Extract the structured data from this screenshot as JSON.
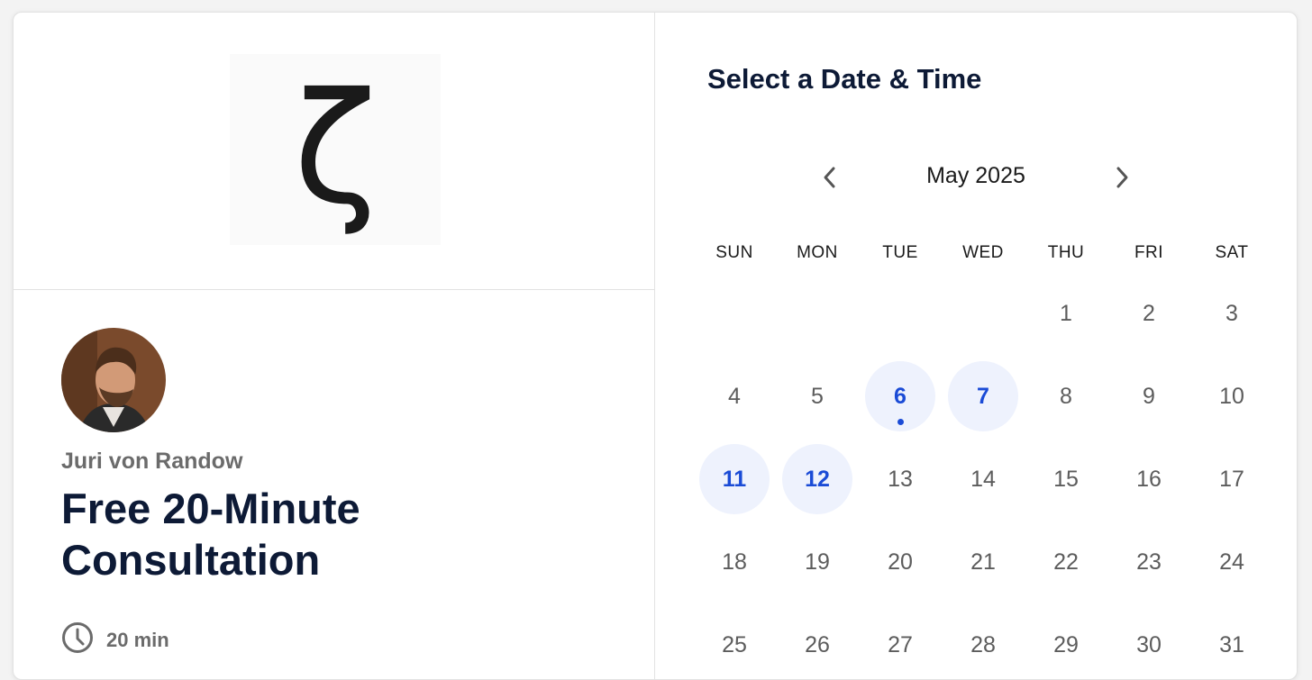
{
  "organizer": {
    "name": "Juri von Randow"
  },
  "event": {
    "title": "Free 20-Minute Consultation",
    "duration": "20 min"
  },
  "logo": {
    "glyph": "ζ"
  },
  "scheduler": {
    "heading": "Select a Date & Time",
    "month_label": "May 2025",
    "weekdays": [
      "SUN",
      "MON",
      "TUE",
      "WED",
      "THU",
      "FRI",
      "SAT"
    ],
    "days": [
      {
        "label": "",
        "available": false
      },
      {
        "label": "",
        "available": false
      },
      {
        "label": "",
        "available": false
      },
      {
        "label": "",
        "available": false
      },
      {
        "label": "1",
        "available": false
      },
      {
        "label": "2",
        "available": false
      },
      {
        "label": "3",
        "available": false
      },
      {
        "label": "4",
        "available": false
      },
      {
        "label": "5",
        "available": false
      },
      {
        "label": "6",
        "available": true,
        "today": true
      },
      {
        "label": "7",
        "available": true
      },
      {
        "label": "8",
        "available": false
      },
      {
        "label": "9",
        "available": false
      },
      {
        "label": "10",
        "available": false
      },
      {
        "label": "11",
        "available": true
      },
      {
        "label": "12",
        "available": true
      },
      {
        "label": "13",
        "available": false
      },
      {
        "label": "14",
        "available": false
      },
      {
        "label": "15",
        "available": false
      },
      {
        "label": "16",
        "available": false
      },
      {
        "label": "17",
        "available": false
      },
      {
        "label": "18",
        "available": false
      },
      {
        "label": "19",
        "available": false
      },
      {
        "label": "20",
        "available": false
      },
      {
        "label": "21",
        "available": false
      },
      {
        "label": "22",
        "available": false
      },
      {
        "label": "23",
        "available": false
      },
      {
        "label": "24",
        "available": false
      },
      {
        "label": "25",
        "available": false
      },
      {
        "label": "26",
        "available": false
      },
      {
        "label": "27",
        "available": false
      },
      {
        "label": "28",
        "available": false
      },
      {
        "label": "29",
        "available": false
      },
      {
        "label": "30",
        "available": false
      },
      {
        "label": "31",
        "available": false
      }
    ]
  },
  "colors": {
    "accent": "#1a4bd6",
    "available_bg": "#eef2fd",
    "title": "#0d1a36"
  }
}
